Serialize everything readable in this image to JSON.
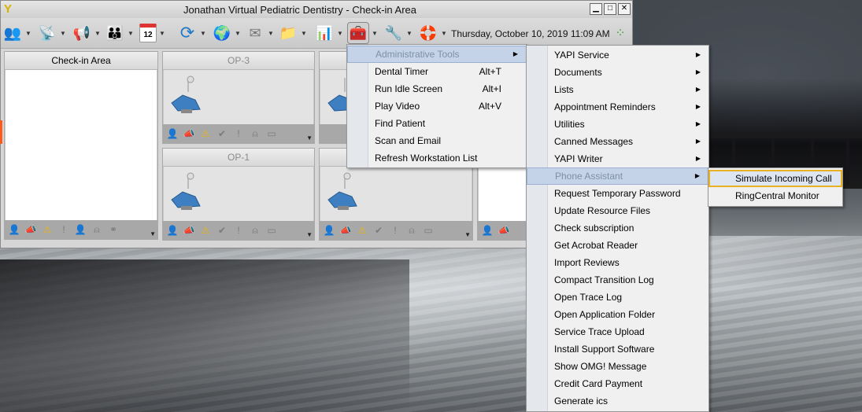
{
  "window": {
    "title": "Jonathan Virtual Pediatric Dentistry - Check-in Area",
    "datetime": "Thursday, October 10, 2019 11:09 AM",
    "calendar_day": "12"
  },
  "toolbar": {
    "icons": [
      "patients-icon",
      "antenna-icon",
      "megaphone-icon",
      "people-icon",
      "calendar-icon",
      "refresh-icon",
      "globe-icon",
      "mail-icon",
      "folder-icon",
      "chart-icon",
      "toolbox-icon",
      "wrench-icon",
      "lifebuoy-icon",
      "grid-icon"
    ]
  },
  "panels": {
    "checkin": {
      "title": "Check-in Area"
    },
    "op3": {
      "title": "OP-3"
    },
    "op1": {
      "title": "OP-1"
    }
  },
  "menu_main": {
    "items": [
      {
        "label": "Administrative Tools",
        "shortcut": ""
      },
      {
        "label": "Dental Timer",
        "shortcut": "Alt+T"
      },
      {
        "label": "Run Idle Screen",
        "shortcut": "Alt+I"
      },
      {
        "label": "Play Video",
        "shortcut": "Alt+V"
      },
      {
        "label": "Find Patient",
        "shortcut": ""
      },
      {
        "label": "Scan and Email",
        "shortcut": ""
      },
      {
        "label": "Refresh Workstation List",
        "shortcut": ""
      }
    ]
  },
  "menu_admin": {
    "items": [
      {
        "label": "YAPI Service"
      },
      {
        "label": "Documents"
      },
      {
        "label": "Lists"
      },
      {
        "label": "Appointment Reminders"
      },
      {
        "label": "Utilities"
      },
      {
        "label": "Canned Messages"
      },
      {
        "label": "YAPI Writer"
      },
      {
        "label": "Phone Assistant"
      },
      {
        "label": "Request Temporary Password"
      },
      {
        "label": "Update Resource Files"
      },
      {
        "label": "Check subscription"
      },
      {
        "label": "Get Acrobat Reader"
      },
      {
        "label": "Import Reviews"
      },
      {
        "label": "Compact Transition Log"
      },
      {
        "label": "Open Trace Log"
      },
      {
        "label": "Open Application Folder"
      },
      {
        "label": "Service Trace Upload"
      },
      {
        "label": "Install Support Software"
      },
      {
        "label": "Show OMG! Message"
      },
      {
        "label": "Credit Card Payment"
      },
      {
        "label": "Generate ics"
      }
    ]
  },
  "menu_phone": {
    "items": [
      {
        "label": "Simulate Incoming Call"
      },
      {
        "label": "RingCentral Monitor"
      }
    ]
  },
  "colors": {
    "menu_selected": "#c5d3e8",
    "highlight_box": "#e8b023"
  }
}
